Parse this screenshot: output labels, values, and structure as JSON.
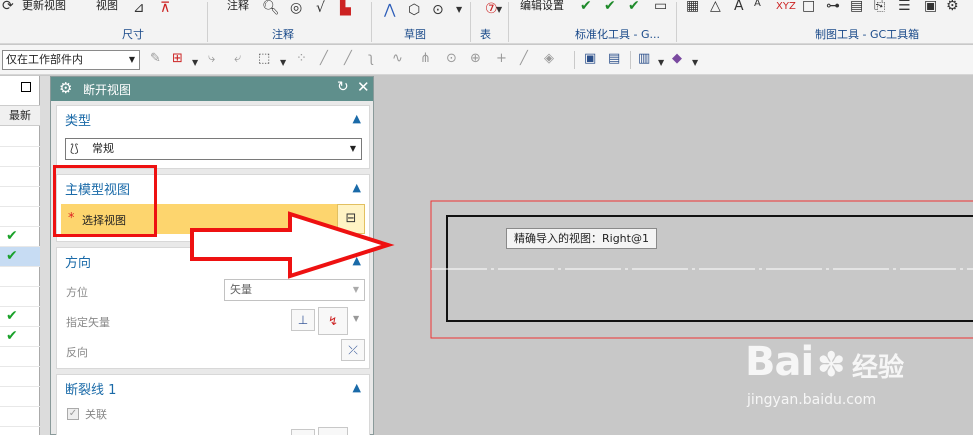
{
  "ribbon": {
    "top_labels": [
      "更新视图",
      "视图"
    ],
    "groups": [
      "尺寸",
      "注释",
      "草图",
      "表",
      "标准化工具 - G...",
      "制图工具 - GC工具箱"
    ],
    "top_right_labels": [
      "编辑设置",
      "XYZ"
    ]
  },
  "toolbar": {
    "filter_value": "仅在工作部件内"
  },
  "left_panel": {
    "column_header": "最新",
    "rows": [
      {
        "checked": false,
        "selected": false
      },
      {
        "checked": false,
        "selected": false
      },
      {
        "checked": false,
        "selected": false
      },
      {
        "checked": false,
        "selected": false
      },
      {
        "checked": false,
        "selected": false
      },
      {
        "checked": true,
        "selected": false
      },
      {
        "checked": true,
        "selected": true
      },
      {
        "checked": false,
        "selected": false
      },
      {
        "checked": false,
        "selected": false
      },
      {
        "checked": true,
        "selected": false
      },
      {
        "checked": true,
        "selected": false
      },
      {
        "checked": false,
        "selected": false
      },
      {
        "checked": false,
        "selected": false
      },
      {
        "checked": false,
        "selected": false
      },
      {
        "checked": false,
        "selected": false
      }
    ]
  },
  "dialog": {
    "title": "断开视图",
    "type_section": {
      "heading": "类型",
      "selected_value": "常规"
    },
    "main_model_section": {
      "heading": "主模型视图",
      "select_label": "选择视图",
      "required_marker": "*"
    },
    "direction_section": {
      "heading": "方向",
      "orientation_label": "方位",
      "orientation_value": "矢量",
      "specify_vector_label": "指定矢量",
      "reverse_label": "反向"
    },
    "break_line_section": {
      "heading": "断裂线 1",
      "associate_label": "关联",
      "associate_checked": true
    }
  },
  "canvas": {
    "tooltip": "精确导入的视图：Right@1"
  },
  "watermark": {
    "brand": "Bai",
    "brand_cn": "经验",
    "url": "jingyan.baidu.com"
  },
  "colors": {
    "dialog_title_bg": "#5f8f8c",
    "section_heading": "#1a6aa8",
    "highlight": "#fdd56e",
    "annotation_red": "#e11111",
    "check_green": "#1aa12a"
  }
}
